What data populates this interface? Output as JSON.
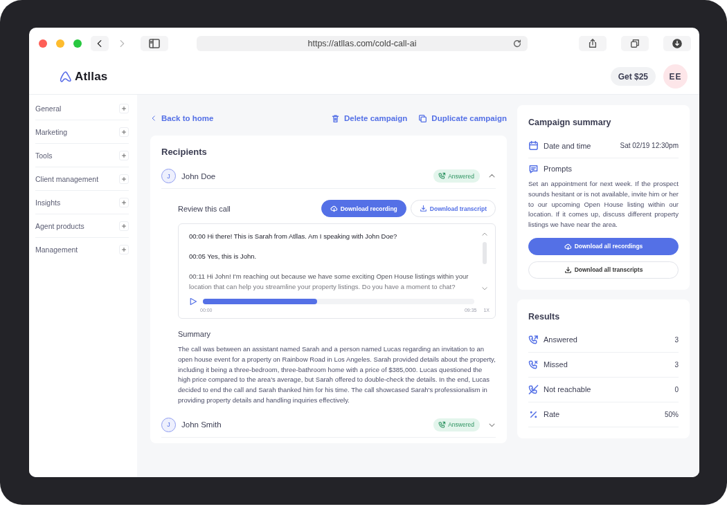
{
  "browser": {
    "url": "https://atllas.com/cold-call-ai"
  },
  "header": {
    "logo": "Atllas",
    "promo_button": "Get $25",
    "avatar": "EE"
  },
  "sidebar": {
    "items": [
      {
        "label": "General",
        "expanded": false
      },
      {
        "label": "Marketing",
        "expanded": false
      },
      {
        "label": "Tools",
        "expanded": false
      },
      {
        "label": "Client management",
        "expanded": false
      },
      {
        "label": "Insights",
        "expanded": false
      },
      {
        "label": "Agent products",
        "expanded": false
      },
      {
        "label": "Management",
        "expanded": false
      }
    ]
  },
  "toolbar": {
    "back": "Back to home",
    "actions": [
      {
        "kind": "delete",
        "label": "Delete campaign"
      },
      {
        "kind": "duplicate",
        "label": "Duplicate campaign"
      }
    ]
  },
  "recipients": {
    "title": "Recipients",
    "items": [
      {
        "initial": "J",
        "name": "John Doe",
        "status": "Answered",
        "expanded": true,
        "review": {
          "title": "Review this call",
          "buttons": [
            {
              "kind": "primary",
              "label": "Download recording"
            },
            {
              "kind": "secondary",
              "label": "Download transcript"
            }
          ],
          "transcript": [
            {
              "time": "00:00",
              "text": "Hi there! This is Sarah from Atllas. Am I speaking with John Doe?"
            },
            {
              "time": "00:05",
              "text": "Yes, this is John."
            },
            {
              "time": "00:11",
              "text": "Hi John! I'm reaching out because we have some exciting Open House listings within your location that can help you streamline your property listings. Do you have a moment to chat?"
            }
          ],
          "player": {
            "level": 0.42,
            "start": "00:00",
            "end": "09:35",
            "speed": "1X"
          },
          "summary_title": "Summary",
          "summary": "The call was between an assistant named Sarah and a person named Lucas regarding an invitation to an open house event for a property on Rainbow Road in Los Angeles. Sarah provided details about the property, including it being a three-bedroom, three-bathroom home with a price of $385,000. Lucas questioned the high price compared to the area's average, but Sarah offered to double-check the details. In the end, Lucas decided to end the call and Sarah thanked him for his time. The call showcased Sarah's professionalism in providing property details and handling inquiries effectively."
        }
      },
      {
        "initial": "J",
        "name": "John Smith",
        "status": "Answered",
        "expanded": false
      }
    ]
  },
  "campaign_summary": {
    "title": "Campaign summary",
    "date_label": "Date and time",
    "date_value": "Sat 02/19 12:30pm",
    "prompts_label": "Prompts",
    "prompts_text": "Set an appointment for next week. If the prospect sounds hesitant or is not available, invite him or her to our upcoming Open House listing within our location. If it comes up, discuss different property listings we have near the area.",
    "buttons": [
      {
        "kind": "primary",
        "label": "Download all recordings"
      },
      {
        "kind": "secondary",
        "label": "Download all transcripts"
      }
    ]
  },
  "results": {
    "title": "Results",
    "rows": [
      {
        "kind": "answered",
        "label": "Answered",
        "value": "3"
      },
      {
        "kind": "missed",
        "label": "Missed",
        "value": "3"
      },
      {
        "kind": "unreachable",
        "label": "Not reachable",
        "value": "0"
      },
      {
        "kind": "rate",
        "label": "Rate",
        "value": "50%"
      }
    ]
  }
}
